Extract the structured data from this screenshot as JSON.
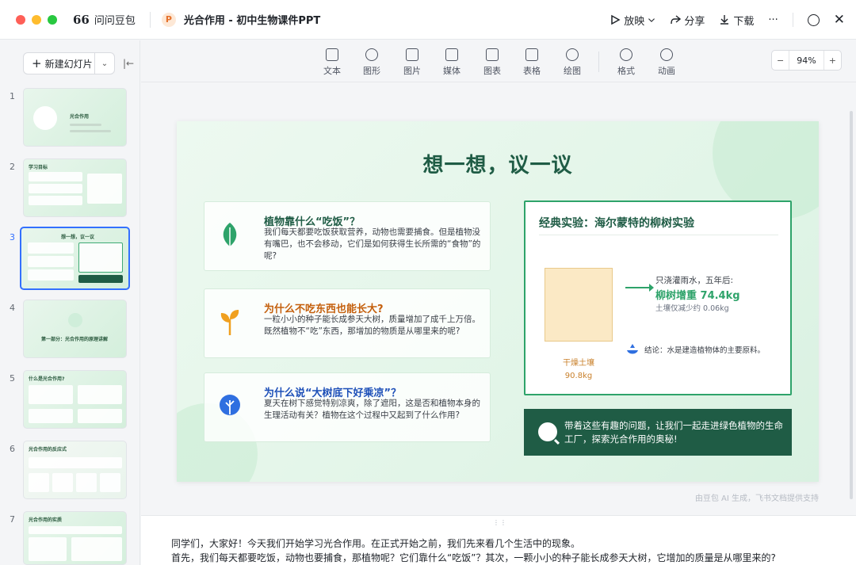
{
  "window": {
    "app_name": "问问豆包",
    "app_glyph": "66",
    "doc_badge": "P",
    "doc_title": "光合作用 - 初中生物课件PPT"
  },
  "titlebar_actions": {
    "present": "放映",
    "share": "分享",
    "download": "下载",
    "more": "···"
  },
  "sidebar": {
    "new_slide": "新建幻灯片",
    "thumbnails": [
      {
        "num": "1",
        "title": "光合作用"
      },
      {
        "num": "2",
        "title": "学习目标"
      },
      {
        "num": "3",
        "title": "想一想，议一议"
      },
      {
        "num": "4",
        "title": "第一部分：光合作用的原理讲解"
      },
      {
        "num": "5",
        "title": "什么是光合作用?"
      },
      {
        "num": "6",
        "title": "光合作用的反应式"
      },
      {
        "num": "7",
        "title": "光合作用的实质"
      }
    ],
    "selected_index": 3
  },
  "toolbar": {
    "tools": [
      "文本",
      "图形",
      "图片",
      "媒体",
      "图表",
      "表格",
      "绘图",
      "格式",
      "动画"
    ],
    "zoom_minus": "−",
    "zoom_value": "94%",
    "zoom_plus": "+"
  },
  "slide": {
    "title": "想一想，议一议",
    "questions": [
      {
        "heading": "植物靠什么“吃饭”？",
        "body": "我们每天都要吃饭获取营养，动物也需要捕食。但是植物没有嘴巴，也不会移动，它们是如何获得生长所需的“食物”的呢?",
        "color": "#1f5c45",
        "icon": "leaf-icon"
      },
      {
        "heading": "为什么不吃东西也能长大?",
        "body": "一粒小小的种子能长成参天大树，质量增加了成千上万倍。既然植物不“吃”东西，那增加的物质是从哪里来的呢?",
        "color": "#c45f0c",
        "icon": "sprout-icon"
      },
      {
        "heading": "为什么说“大树底下好乘凉”？",
        "body": "夏天在树下感觉特别凉爽，除了遮阳，这是否和植物本身的生理活动有关？植物在这个过程中又起到了什么作用?",
        "color": "#1d4fb8",
        "icon": "tree-icon"
      }
    ],
    "experiment": {
      "title": "经典实验：海尔蒙特的柳树实验",
      "soil_label": "干燥土壤",
      "soil_weight": "90.8kg",
      "condition": "只浇灌雨水，五年后:",
      "result": "柳树增重 74.4kg",
      "soil_change": "土壤仅减少约 0.06kg",
      "conclusion": "结论：水是建造植物体的主要原料。"
    },
    "banner": "带着这些有趣的问题，让我们一起走进绿色植物的生命工厂，探索光合作用的奥秘!"
  },
  "watermark": "由豆包 AI 生成，飞书文档提供支持",
  "notes": {
    "line1": "同学们，大家好！今天我们开始学习光合作用。在正式开始之前，我们先来看几个生活中的现象。",
    "line2": "首先，我们每天都要吃饭，动物也要捕食，那植物呢？它们靠什么“吃饭”？其次，一颗小小的种子能长成参天大树，它增加的质量是从哪里来的?"
  },
  "colors": {
    "brand_green": "#1f5c45",
    "accent_green": "#2ea36a",
    "selection_blue": "#3370ff"
  }
}
